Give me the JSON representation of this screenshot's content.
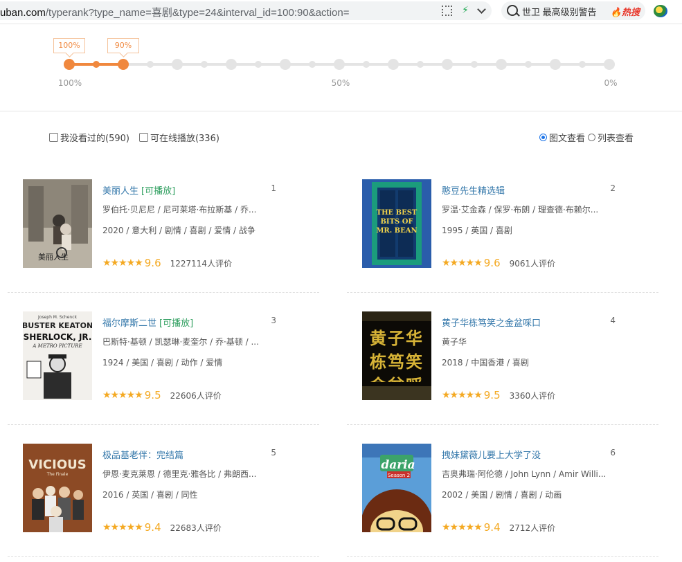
{
  "browser": {
    "url_host": "uban.com",
    "url_rest": "/typerank?type_name=喜剧&type=24&interval_id=100:90&action=",
    "search_text": "世卫 最高级别警告",
    "hot_label": "热搜",
    "icons": [
      "qr-icon",
      "lightning-icon",
      "chevron-down-icon",
      "search-icon",
      "fire-icon",
      "extension-icon"
    ]
  },
  "slider": {
    "tips": [
      "100%",
      "90%"
    ],
    "scale_labels": [
      "100%",
      "50%",
      "0%"
    ],
    "selected_range": [
      100,
      90
    ],
    "accent": "#f0883e"
  },
  "filters": {
    "unseen": "我没看过的(590)",
    "online": "可在线播放(336)"
  },
  "views": {
    "picture": "图文查看",
    "list": "列表查看",
    "selected": "picture"
  },
  "movies": [
    {
      "title": "美丽人生",
      "playable": "[可播放]",
      "rank": "1",
      "cast": "罗伯托·贝尼尼 / 尼可莱塔·布拉斯基 / 乔...",
      "meta": "2020 / 意大利 / 剧情 / 喜剧 / 爱情 / 战争",
      "stars": "★★★★★",
      "score": "9.6",
      "votes": "1227114人评价"
    },
    {
      "title": "憨豆先生精选辑",
      "playable": "",
      "rank": "2",
      "cast": "罗温·艾金森 / 保罗·布朗 / 理查德·布赖尔...",
      "meta": "1995 / 英国 / 喜剧",
      "stars": "★★★★★",
      "score": "9.6",
      "votes": "9061人评价"
    },
    {
      "title": "福尔摩斯二世",
      "playable": "[可播放]",
      "rank": "3",
      "cast": "巴斯特·基顿 / 凯瑟琳·麦奎尔 / 乔·基顿 / ...",
      "meta": "1924 / 美国 / 喜剧 / 动作 / 爱情",
      "stars": "★★★★★",
      "score": "9.5",
      "votes": "22606人评价"
    },
    {
      "title": "黄子华栋笃笑之金盆啋口",
      "playable": "",
      "rank": "4",
      "cast": "黄子华",
      "meta": "2018 / 中国香港 / 喜剧",
      "stars": "★★★★★",
      "score": "9.5",
      "votes": "3360人评价"
    },
    {
      "title": "极品基老伴：完结篇",
      "playable": "",
      "rank": "5",
      "cast": "伊恩·麦克莱恩 / 德里克·雅各比 / 弗朗西...",
      "meta": "2016 / 英国 / 喜剧 / 同性",
      "stars": "★★★★★",
      "score": "9.4",
      "votes": "22683人评价"
    },
    {
      "title": "拽妹黛薇儿要上大学了没",
      "playable": "",
      "rank": "6",
      "cast": "吉奥弗瑞·阿伦德 / John Lynn / Amir Willi...",
      "meta": "2002 / 美国 / 剧情 / 喜剧 / 动画",
      "stars": "★★★★★",
      "score": "9.4",
      "votes": "2712人评价"
    }
  ],
  "posters": {
    "p3_top": "Joseph M. Schenck",
    "p3_line1": "BUSTER KEATON",
    "p3_line2": "SHERLOCK, JR.",
    "p3_line3": "A METRO PICTURE",
    "p2_text": "THE BEST BITS OF MR. BEAN",
    "p4_text": "黄子华栋笃笑 金盆啋口",
    "p5_title": "VICIOUS",
    "p5_sub": "The Finale",
    "p6_logo": "daria",
    "p6_season": "Season 2",
    "p1_text": "美丽人生"
  }
}
